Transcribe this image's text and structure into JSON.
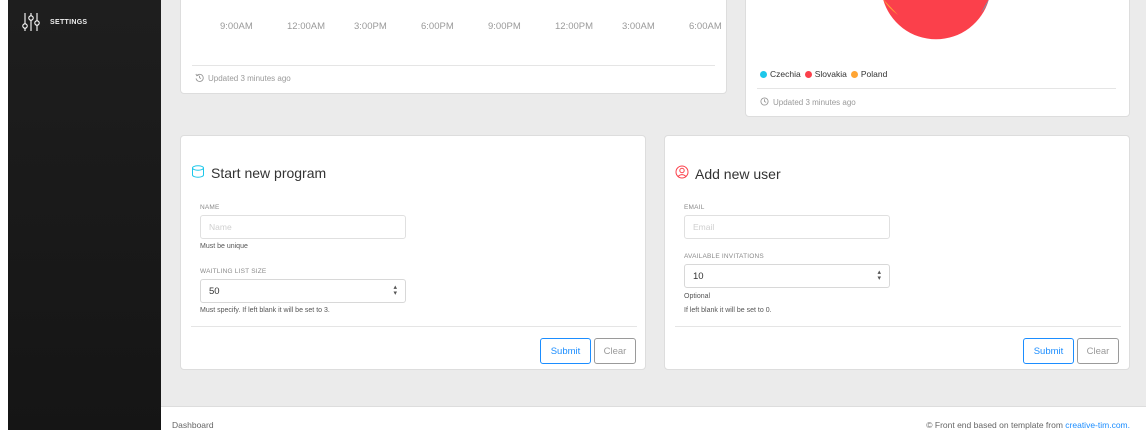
{
  "sidebar": {
    "items": [
      {
        "label": "SETTINGS",
        "icon": "sliders-icon"
      }
    ]
  },
  "chart_card": {
    "x_ticks": [
      "9:00AM",
      "12:00AM",
      "3:00PM",
      "6:00PM",
      "9:00PM",
      "12:00PM",
      "3:00AM",
      "6:00AM"
    ],
    "updated": "Updated 3 minutes ago"
  },
  "pie_card": {
    "legend": [
      {
        "label": "Czechia",
        "color": "#1dc7ea"
      },
      {
        "label": "Slovakia",
        "color": "#fb404b"
      },
      {
        "label": "Poland",
        "color": "#ffa534"
      }
    ],
    "updated": "Updated 3 minutes ago"
  },
  "program_form": {
    "title": "Start new program",
    "name_label": "NAME",
    "name_placeholder": "Name",
    "name_help": "Must be unique",
    "waitlist_label": "WAITLING LIST SIZE",
    "waitlist_value": "50",
    "waitlist_help": "Must specify. If left blank it will be set to 3.",
    "submit": "Submit",
    "clear": "Clear"
  },
  "user_form": {
    "title": "Add new user",
    "email_label": "EMAIL",
    "email_placeholder": "Email",
    "invitations_label": "AVAILABLE INVITATIONS",
    "invitations_value": "10",
    "help_optional": "Optional",
    "help_blank": "If left blank it will be set to 0.",
    "submit": "Submit",
    "clear": "Clear"
  },
  "footer": {
    "left": "Dashboard",
    "right_prefix": "© Front end based on template from ",
    "right_link": "creative-tim.com."
  },
  "colors": {
    "accent": "#1b8dff",
    "pie_slovakia": "#fb404b",
    "pie_czechia": "#1dc7ea",
    "pie_poland": "#ffa534"
  }
}
